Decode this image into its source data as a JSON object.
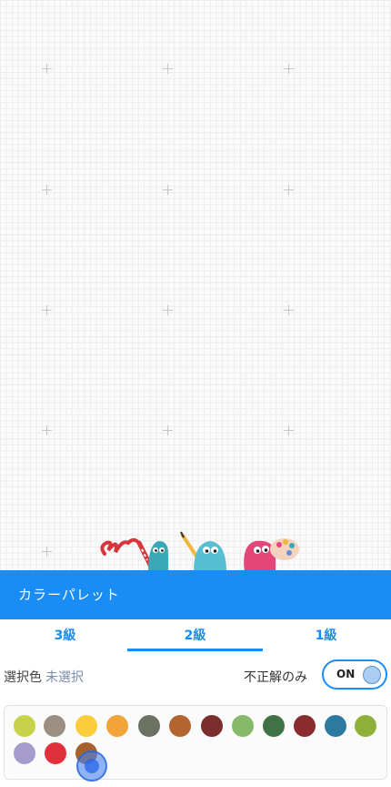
{
  "palette": {
    "title": "カラーパレット",
    "tabs": [
      {
        "label": "3級"
      },
      {
        "label": "2級",
        "active": true
      },
      {
        "label": "1級"
      }
    ],
    "selected_color_label": "選択色",
    "selected_color_value": "未選択",
    "incorrect_only_label": "不正解のみ",
    "toggle_label": "ON",
    "toggle_state": "on",
    "accent_color": "#1a8cf5",
    "swatches": [
      {
        "color": "#c6d34a"
      },
      {
        "color": "#9a8f80"
      },
      {
        "color": "#fbcd3a"
      },
      {
        "color": "#f2a33a"
      },
      {
        "color": "#6b7261"
      },
      {
        "color": "#b4652f"
      },
      {
        "color": "#7c2e2e"
      },
      {
        "color": "#86ba6a"
      },
      {
        "color": "#3f7346"
      },
      {
        "color": "#8a2b2e"
      },
      {
        "color": "#2d7aa1"
      },
      {
        "color": "#8fb13a"
      },
      {
        "color": "#a69ccc"
      },
      {
        "color": "#e0303a"
      },
      {
        "color": "#a5622f"
      }
    ]
  }
}
